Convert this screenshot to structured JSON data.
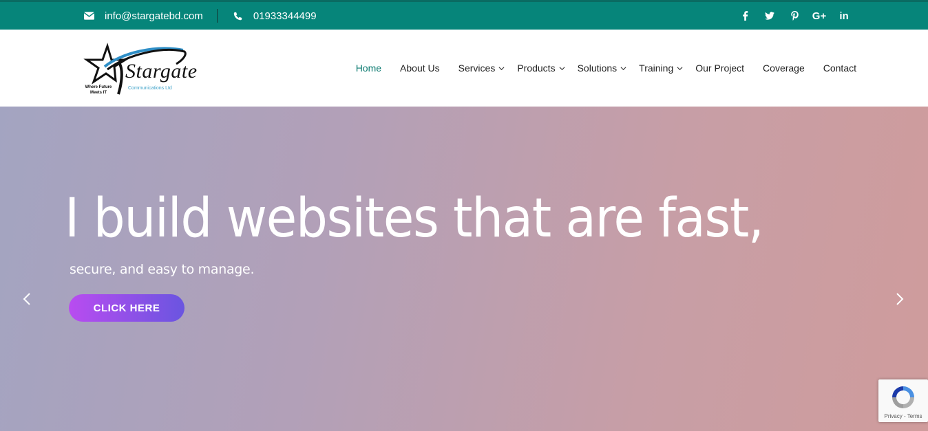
{
  "topbar": {
    "email": "info@stargatebd.com",
    "phone": "01933344499",
    "social": [
      "f",
      "twitter",
      "pinterest",
      "G+",
      "in"
    ]
  },
  "logo": {
    "brand": "Stargate",
    "sub": "Communications Ltd",
    "tagline": "Where Future Meets IT"
  },
  "nav": {
    "items": [
      {
        "label": "Home",
        "active": true,
        "submenu": false
      },
      {
        "label": "About Us",
        "submenu": false
      },
      {
        "label": "Services",
        "submenu": true
      },
      {
        "label": "Products",
        "submenu": true
      },
      {
        "label": "Solutions",
        "submenu": true
      },
      {
        "label": "Training",
        "submenu": true
      },
      {
        "label": "Our Project",
        "submenu": false
      },
      {
        "label": "Coverage",
        "submenu": false
      },
      {
        "label": "Contact",
        "submenu": false
      }
    ]
  },
  "hero": {
    "headline": "I build websites that are fast,",
    "subline": "secure, and easy to manage.",
    "cta": "CLICK HERE"
  },
  "recaptcha": {
    "text": "Privacy - Terms"
  },
  "colors": {
    "topbar": "#06857a",
    "accent": "#0b7a70",
    "cta_start": "#b94cf0",
    "cta_end": "#6a55e0"
  }
}
